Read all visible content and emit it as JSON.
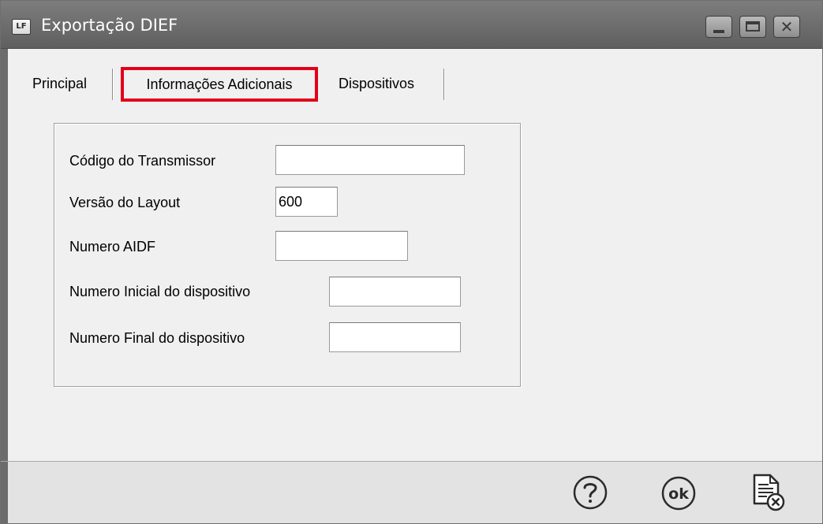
{
  "window": {
    "title": "Exportação DIEF",
    "app_icon_text": "LF"
  },
  "tabs": [
    {
      "label": "Principal"
    },
    {
      "label": "Informações Adicionais",
      "selected": true,
      "highlight_color": "#e2001a"
    },
    {
      "label": "Dispositivos"
    }
  ],
  "form": {
    "codigo_transmissor": {
      "label": "Código do Transmissor",
      "value": ""
    },
    "versao_layout": {
      "label": "Versão do Layout",
      "value": "600"
    },
    "numero_aidf": {
      "label": "Numero AIDF",
      "value": ""
    },
    "numero_inicial": {
      "label": "Numero Inicial do dispositivo",
      "value": ""
    },
    "numero_final": {
      "label": "Numero Final do dispositivo",
      "value": ""
    }
  },
  "footer": {
    "help_icon": "help-icon",
    "ok_icon_text": "ok",
    "cancel_icon": "cancel-document-icon"
  },
  "colors": {
    "titlebar": "#6b6b6b",
    "tab_highlight": "#e2001a",
    "window_bg": "#f0f0f0",
    "footer_bg": "#e3e3e3"
  }
}
